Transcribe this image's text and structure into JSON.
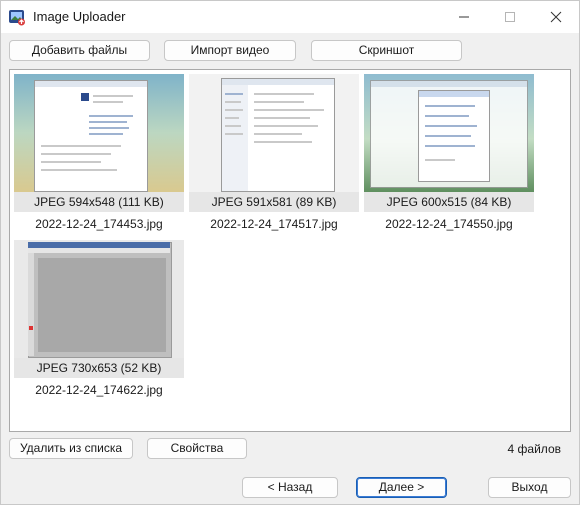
{
  "window": {
    "title": "Image Uploader"
  },
  "toolbar": {
    "add_files": "Добавить файлы",
    "import_video": "Импорт видео",
    "screenshot": "Скриншот"
  },
  "files": [
    {
      "info": "JPEG 594x548 (111 KB)",
      "name": "2022-12-24_174453.jpg"
    },
    {
      "info": "JPEG 591x581 (89 KB)",
      "name": "2022-12-24_174517.jpg"
    },
    {
      "info": "JPEG 600x515 (84 KB)",
      "name": "2022-12-24_174550.jpg"
    },
    {
      "info": "JPEG 730x653 (52 KB)",
      "name": "2022-12-24_174622.jpg"
    }
  ],
  "bottom": {
    "remove": "Удалить из списка",
    "properties": "Свойства",
    "count": "4 файлов"
  },
  "nav": {
    "back": "< Назад",
    "next": "Далее >",
    "exit": "Выход"
  },
  "colors": {
    "accent": "#1a5fb4",
    "tile_bg": "#e6e6e6"
  }
}
